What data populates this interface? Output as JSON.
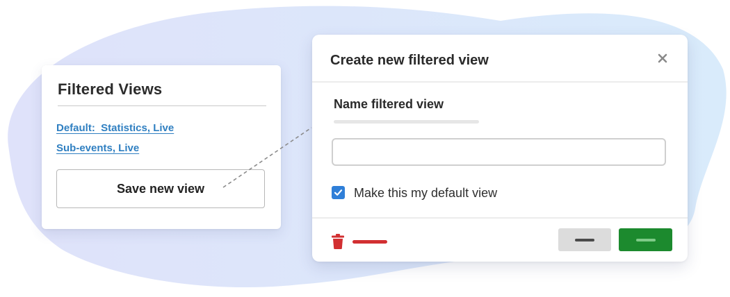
{
  "left_panel": {
    "title": "Filtered Views",
    "links": [
      "Default:  Statistics, Live",
      "Sub-events, Live"
    ],
    "save_button_label": "Save new view"
  },
  "modal": {
    "title": "Create new filtered view",
    "close_icon": "close-icon",
    "field_label": "Name filtered view",
    "input_value": "",
    "checkbox": {
      "label": "Make this my default view",
      "checked": true
    },
    "delete_icon": "trash-icon"
  },
  "colors": {
    "link": "#2f7fc1",
    "checkbox": "#2f7fd8",
    "delete": "#d22f31",
    "confirm_button": "#1c8a2e",
    "cancel_button": "#dcdcdc",
    "blob_left": "#dfe3fa",
    "blob_right": "#dcecfb"
  }
}
